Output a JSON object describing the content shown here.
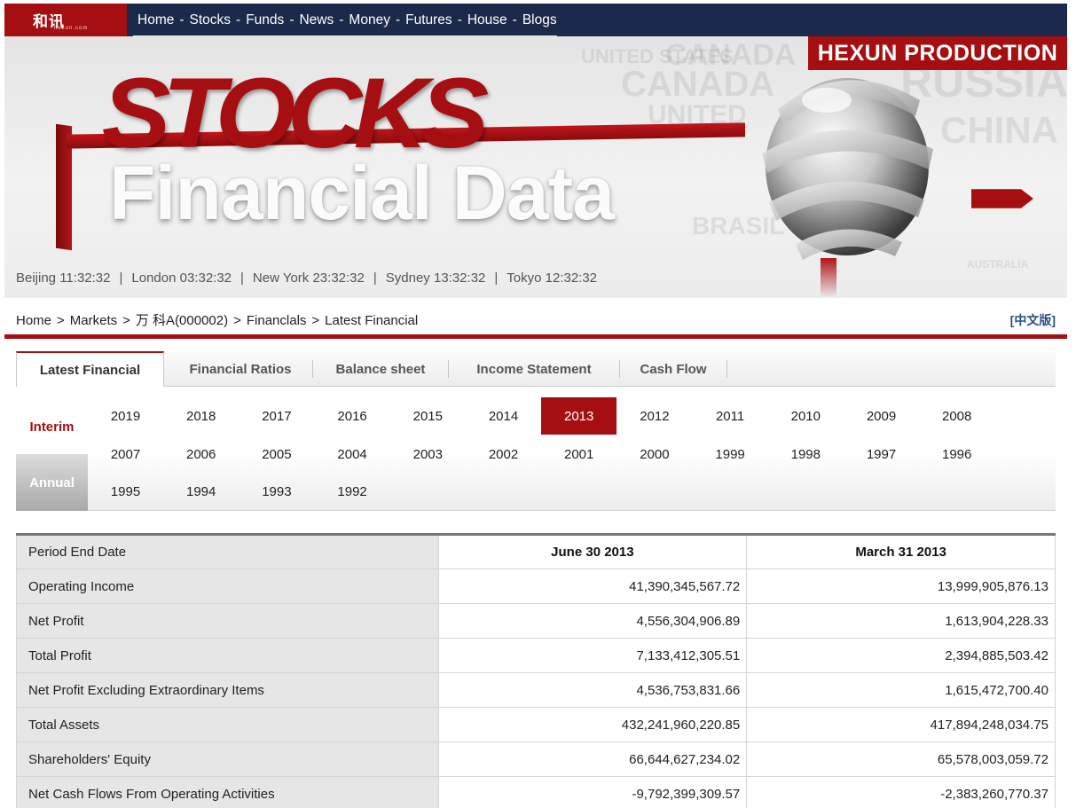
{
  "logo": {
    "text": "和讯",
    "subtext": "hexun.com"
  },
  "nav": {
    "items": [
      "Home",
      "Stocks",
      "Funds",
      "News",
      "Money",
      "Futures",
      "House",
      "Blogs"
    ],
    "separator": "-"
  },
  "banner": {
    "production": "HEXUN PRODUCTION",
    "title_top": "STOCKS",
    "title_bottom": "Financial Data",
    "map_words": [
      "UNITED STATES",
      "CANADA",
      "CANADA",
      "UNITED",
      "RUSSIA",
      "CHINA",
      "BRASIL",
      "AUSTRALIA"
    ]
  },
  "clocks": [
    {
      "city": "Beijing",
      "time": "11:32:32"
    },
    {
      "city": "London",
      "time": "03:32:32"
    },
    {
      "city": "New York",
      "time": "23:32:32"
    },
    {
      "city": "Sydney",
      "time": "13:32:32"
    },
    {
      "city": "Tokyo",
      "time": "12:32:32"
    }
  ],
  "breadcrumb": {
    "items": [
      "Home",
      "Markets",
      "万 科A(000002)",
      "Financlals",
      "Latest Financial"
    ],
    "separator": ">"
  },
  "cn_link": "[中文版]",
  "tabs": [
    "Latest Financial",
    "Financial Ratios",
    "Balance sheet",
    "Income Statement",
    "Cash Flow"
  ],
  "active_tab": "Latest Financial",
  "periods": {
    "interim": "Interim",
    "annual": "Annual",
    "active": "Interim"
  },
  "years": [
    [
      "2019",
      "2018",
      "2017",
      "2016",
      "2015",
      "2014",
      "2013",
      "2012",
      "2011",
      "2010",
      "2009",
      "2008"
    ],
    [
      "2007",
      "2006",
      "2005",
      "2004",
      "2003",
      "2002",
      "2001",
      "2000",
      "1999",
      "1998",
      "1997",
      "1996"
    ],
    [
      "1995",
      "1994",
      "1993",
      "1992"
    ]
  ],
  "selected_year": "2013",
  "table": {
    "header": {
      "label": "Period End Date",
      "col1": "June 30 2013",
      "col2": "March 31 2013"
    },
    "rows": [
      {
        "label": "Operating Income",
        "v1": "41,390,345,567.72",
        "v2": "13,999,905,876.13"
      },
      {
        "label": "Net Profit",
        "v1": "4,556,304,906.89",
        "v2": "1,613,904,228.33"
      },
      {
        "label": "Total Profit",
        "v1": "7,133,412,305.51",
        "v2": "2,394,885,503.42"
      },
      {
        "label": "Net Profit Excluding Extraordinary Items",
        "v1": "4,536,753,831.66",
        "v2": "1,615,472,700.40"
      },
      {
        "label": "Total Assets",
        "v1": "432,241,960,220.85",
        "v2": "417,894,248,034.75"
      },
      {
        "label": "Shareholders' Equity",
        "v1": "66,644,627,234.02",
        "v2": "65,578,003,059.72"
      },
      {
        "label": "Net Cash Flows From Operating Activities",
        "v1": "-9,792,399,309.57",
        "v2": "-2,383,260,770.37"
      }
    ]
  },
  "colors": {
    "brand_red": "#a50f12",
    "nav_bg": "#1b2a4a",
    "link_blue": "#2e4c7d"
  }
}
